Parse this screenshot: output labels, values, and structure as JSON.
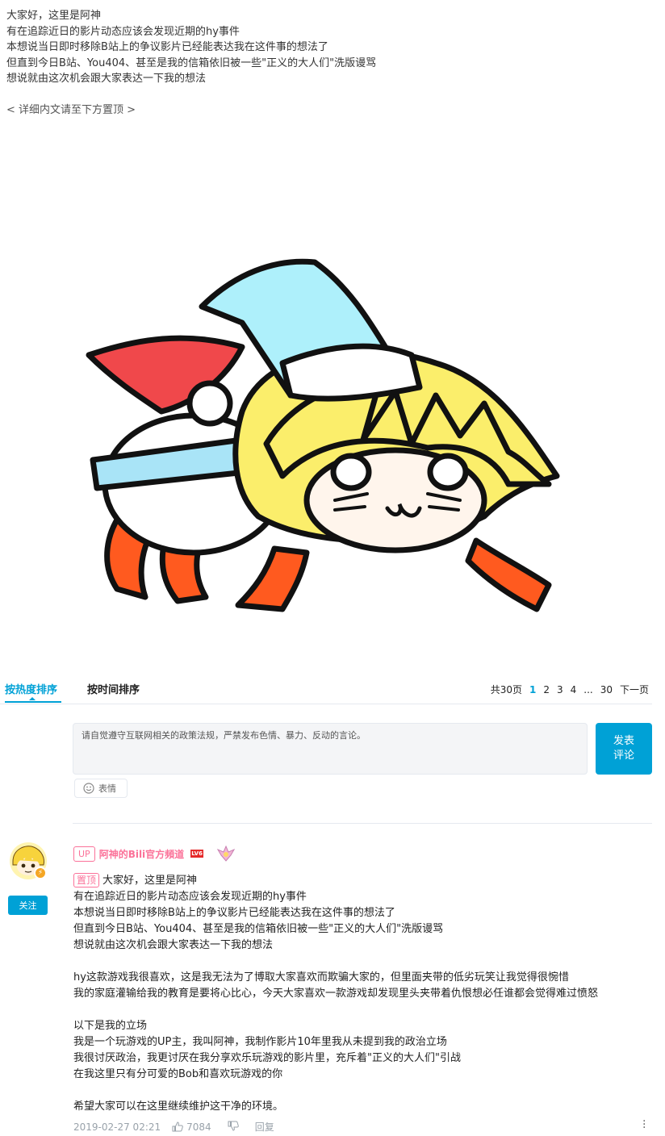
{
  "intro": {
    "lines": [
      "大家好，这里是阿神",
      "有在追踪近日的影片动态应该会发现近期的hy事件",
      "本想说当日即时移除B站上的争议影片已经能表达我在这件事的想法了",
      "但直到今日B站、You404、甚至是我的信箱依旧被一些\"正义的大人们\"洗版谩骂",
      "想说就由这次机会跟大家表达一下我的想法"
    ],
    "hint": "< 详细内文请至下方置顶 >"
  },
  "sort": {
    "hot_label": "按热度排序",
    "time_label": "按时间排序"
  },
  "pager": {
    "total": "共30页",
    "pages": [
      "1",
      "2",
      "3",
      "4"
    ],
    "ellipsis": "...",
    "last": "30",
    "next": "下一页"
  },
  "composer": {
    "placeholder": "请自觉遵守互联网相关的政策法规，严禁发布色情、暴力、反动的言论。",
    "submit_line1": "发表",
    "submit_line2": "评论",
    "emoji_label": "表情"
  },
  "comment": {
    "up_tag": "UP",
    "username": "阿神的Bili官方頻道",
    "level": "LV6",
    "follow_label": "关注",
    "pin_tag": "置顶",
    "paragraphs": [
      [
        "大家好，这里是阿神",
        "有在追踪近日的影片动态应该会发现近期的hy事件",
        "本想说当日即时移除B站上的争议影片已经能表达我在这件事的想法了",
        "但直到今日B站、You404、甚至是我的信箱依旧被一些\"正义的大人们\"洗版谩骂",
        "想说就由这次机会跟大家表达一下我的想法"
      ],
      [
        "hy这款游戏我很喜欢，这是我无法为了博取大家喜欢而欺骗大家的，但里面夹带的低劣玩笑让我觉得很惋惜",
        "我的家庭灌输给我的教育是要将心比心，今天大家喜欢一款游戏却发现里头夹带着仇恨想必任谁都会觉得难过愤怒"
      ],
      [
        "以下是我的立场",
        "我是一个玩游戏的UP主，我叫阿神，我制作影片10年里我从未提到我的政治立场",
        "我很讨厌政治，我更讨厌在我分享欢乐玩游戏的影片里，充斥着\"正义的大人们\"引战",
        "在我这里只有分可爱的Bob和喜欢玩游戏的你"
      ],
      [
        "希望大家可以在这里继续维护这干净的环境。"
      ]
    ],
    "timestamp": "2019-02-27 02:21",
    "likes": "7084",
    "reply_label": "回复"
  },
  "colors": {
    "accent": "#00a1d6",
    "pink": "#fb7299",
    "meta_gray": "#99a2aa"
  },
  "icons": [
    "thumbs-up-icon",
    "thumbs-down-icon",
    "emoji-icon",
    "more-icon",
    "medal-icon",
    "lightning-badge-icon"
  ]
}
